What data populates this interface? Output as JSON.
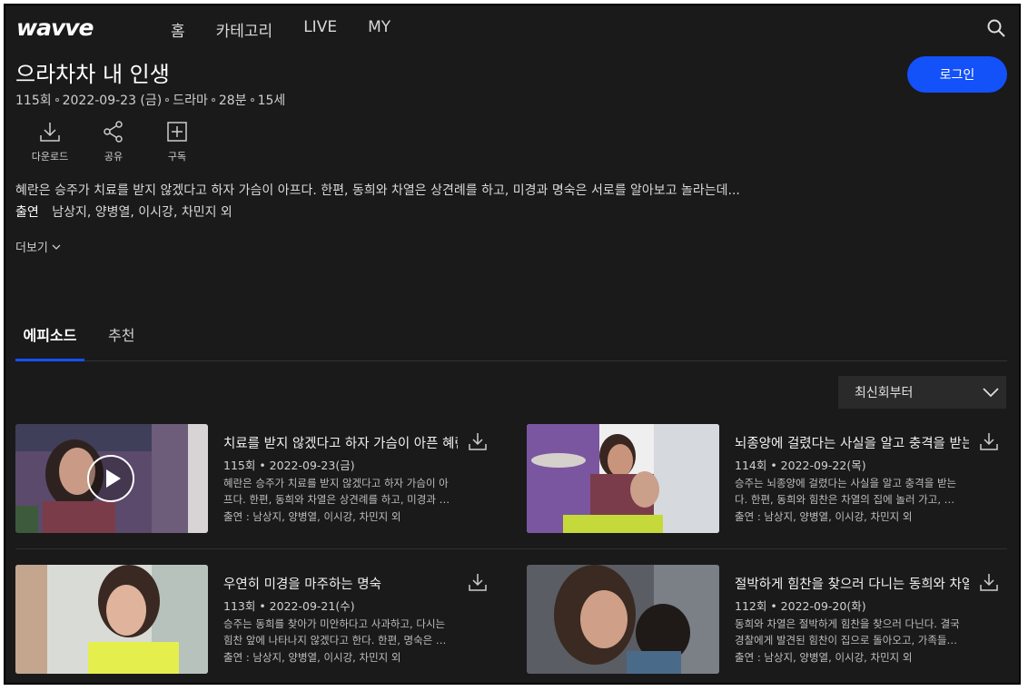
{
  "header": {
    "logo": "wavve",
    "nav": [
      "홈",
      "카테고리",
      "LIVE",
      "MY"
    ],
    "login_label": "로그인"
  },
  "program": {
    "title": "으라차차 내 인생",
    "episode": "115회",
    "date": "2022-09-23 (금)",
    "genre": "드라마",
    "runtime": "28분",
    "rating": "15세",
    "description": "혜란은 승주가 치료를 받지 않겠다고 하자 가슴이 아프다. 한편, 동희와 차열은 상견례를 하고, 미경과 명숙은 서로를 알아보고 놀라는데...",
    "cast_label": "출연",
    "cast": "남상지, 양병열, 이시강, 차민지 외",
    "more_label": "더보기"
  },
  "actions": [
    "다운로드",
    "공유",
    "구독"
  ],
  "tabs": [
    "에피소드",
    "추천"
  ],
  "sort": {
    "label": "최신회부터"
  },
  "episodes": [
    {
      "title": "치료를 받지 않겠다고 하자 가슴이 아픈 혜란",
      "meta": "115회 • 2022-09-23(금)",
      "desc1": "혜란은 승주가 치료를 받지 않겠다고 하자 가슴이 아",
      "desc2": "프다. 한편, 동희와 차열은 상견례를 하고, 미경과 …",
      "cast": "출연 : 남상지, 양병열, 이시강, 차민지 외"
    },
    {
      "title": "뇌종양에 걸렸다는 사실을 알고 충격을 받는 승주",
      "meta": "114회 • 2022-09-22(목)",
      "desc1": "승주는 뇌종양에 걸렸다는 사실을 알고 충격을 받는",
      "desc2": "다. 한편, 동희와 힘찬은 차열의 집에 놀러 가고, …",
      "cast": "출연 : 남상지, 양병열, 이시강, 차민지 외"
    },
    {
      "title": "우연히 미경을 마주하는 명숙",
      "meta": "113회 • 2022-09-21(수)",
      "desc1": "승주는 동희를 찾아가 미안하다고 사과하고, 다시는",
      "desc2": "힘찬 앞에 나타나지 않겠다고 한다. 한편, 명숙은 …",
      "cast": "출연 : 남상지, 양병열, 이시강, 차민지 외"
    },
    {
      "title": "절박하게 힘찬을 찾으러 다니는 동희와 차열",
      "meta": "112회 • 2022-09-20(화)",
      "desc1": "동희와 차열은 절박하게 힘찬을 찾으러 다닌다. 결국",
      "desc2": "경찰에게 발견된 힘찬이 집으로 돌아오고, 가족들…",
      "cast": "출연 : 남상지, 양병열, 이시강, 차민지 외"
    }
  ],
  "colors": {
    "accent": "#1351f9",
    "background": "#1a1a1a"
  }
}
